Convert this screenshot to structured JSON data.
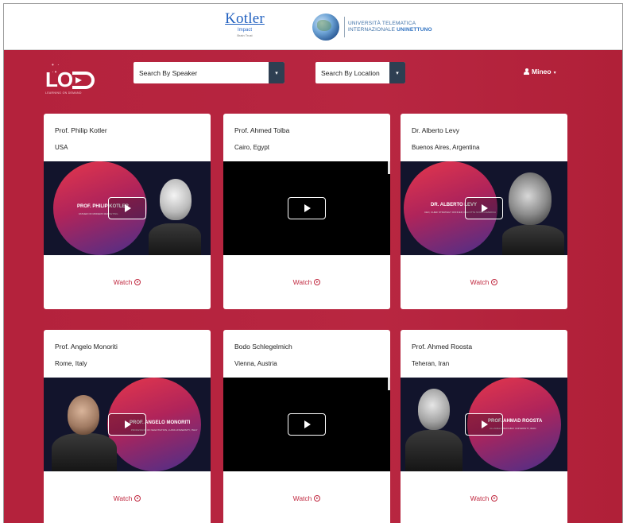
{
  "branding": {
    "kotler_title": "Kotler",
    "kotler_sub": "Impact",
    "kotler_sub2": "Brain Trust",
    "uni_line1": "UNIVERSITÀ TELEMATICA",
    "uni_line2_a": "INTERNAZIONALE ",
    "uni_line2_b": "UNINETTUNO",
    "lod_letters": "LOD",
    "lod_tagline": "LEARNING ON DEMAND"
  },
  "filters": {
    "speaker_placeholder": "Search By Speaker",
    "location_placeholder": "Search By Location",
    "caret_icon": "chevron-down-icon"
  },
  "user": {
    "name": "Mineo",
    "menu_caret": "▾"
  },
  "cards": [
    {
      "name": "Prof. Philip Kotler",
      "location": "USA",
      "poster_title": "PROF. PHILIP KOTLER",
      "poster_sub": "FATHER OF MODERN MARKETING",
      "watch": "Watch"
    },
    {
      "name": "Prof. Ahmed Tolba",
      "location": "Cairo, Egypt",
      "watch": "Watch"
    },
    {
      "name": "Dr. Alberto Levy",
      "location": "Buenos Aires, Argentina",
      "poster_title": "DR. ALBERTO LEVY",
      "poster_sub": "CEO, CHIEF STRATEGY OFFICER, DELOITTE NORTH AMERICA",
      "watch": "Watch"
    },
    {
      "name": "Prof. Angelo Monoriti",
      "location": "Rome, Italy",
      "poster_title": "PROF. ANGELO MONORITI",
      "poster_sub": "PROFESSOR OF NEGOTIATION, LUISS UNIVERSITY, ITALY",
      "watch": "Watch"
    },
    {
      "name": "Bodo Schlegelmich",
      "location": "Vienna, Austria",
      "watch": "Watch"
    },
    {
      "name": "Prof. Ahmed Roosta",
      "location": "Teheran, Iran",
      "poster_title": "PROF. AHMAD ROOSTA",
      "poster_sub": "ALLAMEH TABATABA'I UNIVERSITY, IRAN",
      "watch": "Watch"
    }
  ],
  "colors": {
    "background_red": "#b4223c",
    "select_caret_bg": "#2e3f52",
    "watch_text": "#c0283f"
  }
}
